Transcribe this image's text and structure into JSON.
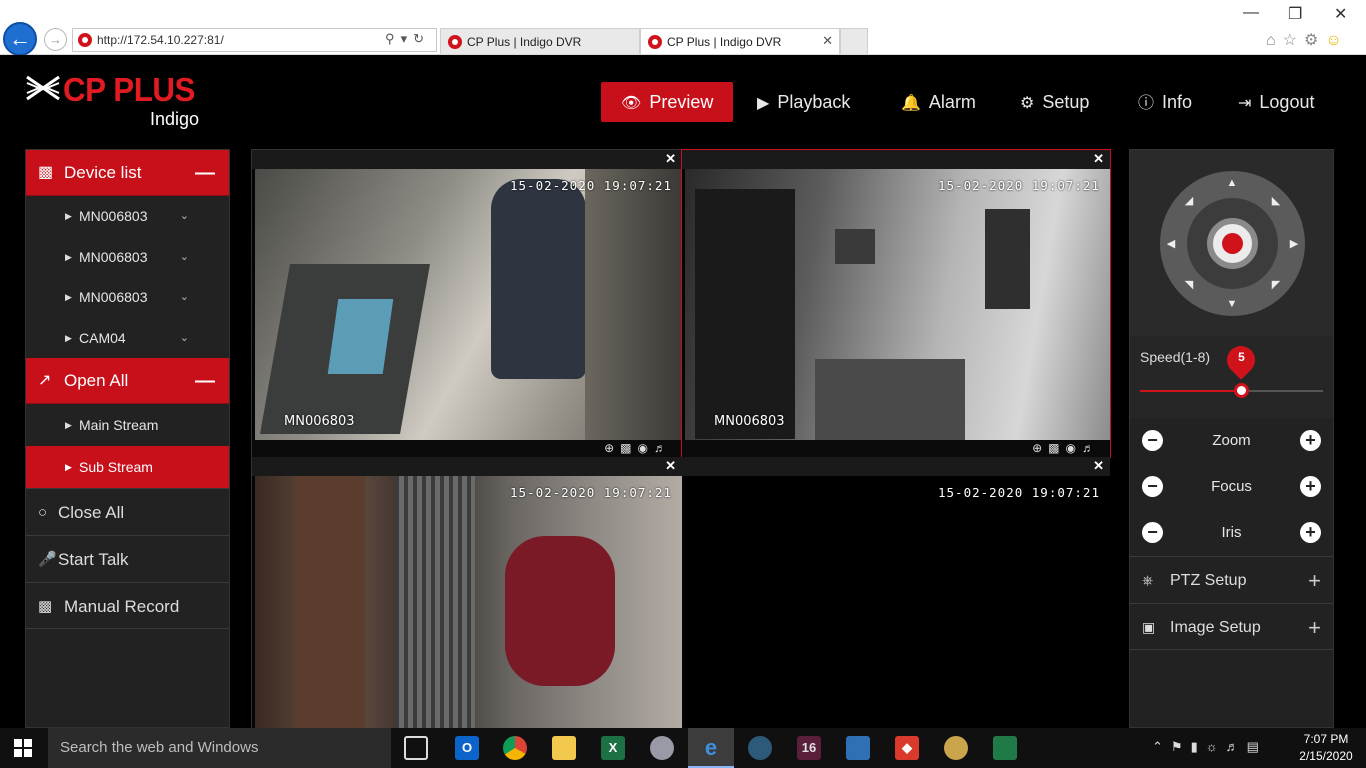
{
  "browser": {
    "url": "http://172.54.10.227:81/",
    "tabs": [
      {
        "title": "CP Plus | Indigo DVR",
        "active": false
      },
      {
        "title": "CP Plus | Indigo DVR",
        "active": true
      }
    ]
  },
  "app": {
    "brand": "CP PLUS",
    "product": "Indigo",
    "nav": [
      {
        "label": "Preview",
        "icon": "eye-icon",
        "active": true
      },
      {
        "label": "Playback",
        "icon": "play-circle-icon"
      },
      {
        "label": "Alarm",
        "icon": "bell-icon"
      },
      {
        "label": "Setup",
        "icon": "gear-icon"
      },
      {
        "label": "Info",
        "icon": "info-icon"
      },
      {
        "label": "Logout",
        "icon": "logout-icon"
      }
    ]
  },
  "left_panel": {
    "device_list": {
      "label": "Device list",
      "items": [
        "MN006803",
        "MN006803",
        "MN006803",
        "CAM04"
      ]
    },
    "open_all": {
      "label": "Open All",
      "items": [
        {
          "label": "Main Stream",
          "active": false
        },
        {
          "label": "Sub Stream",
          "active": true
        }
      ]
    },
    "actions": {
      "close_all": "Close All",
      "start_talk": "Start Talk",
      "manual_record": "Manual Record"
    }
  },
  "video": {
    "tiles": [
      {
        "timestamp": "15-02-2020 19:07:21",
        "camera": "MN006803",
        "selected": false
      },
      {
        "timestamp": "15-02-2020 19:07:21",
        "camera": "MN006803",
        "selected": true
      },
      {
        "timestamp": "15-02-2020 19:07:21",
        "camera": "",
        "selected": false
      },
      {
        "timestamp": "15-02-2020 19:07:21",
        "camera": "",
        "selected": false
      }
    ]
  },
  "ptz": {
    "speed_label": "Speed(1-8)",
    "speed_value": 5,
    "speed_max": 8,
    "zoom": "Zoom",
    "focus": "Focus",
    "iris": "Iris",
    "ptz_setup": "PTZ Setup",
    "image_setup": "Image Setup"
  },
  "taskbar": {
    "search_placeholder": "Search the web and Windows",
    "time": "7:07 PM",
    "date": "2/15/2020"
  },
  "colors": {
    "accent": "#c8101b",
    "panel_bg": "#222222",
    "page_bg": "#000000"
  }
}
